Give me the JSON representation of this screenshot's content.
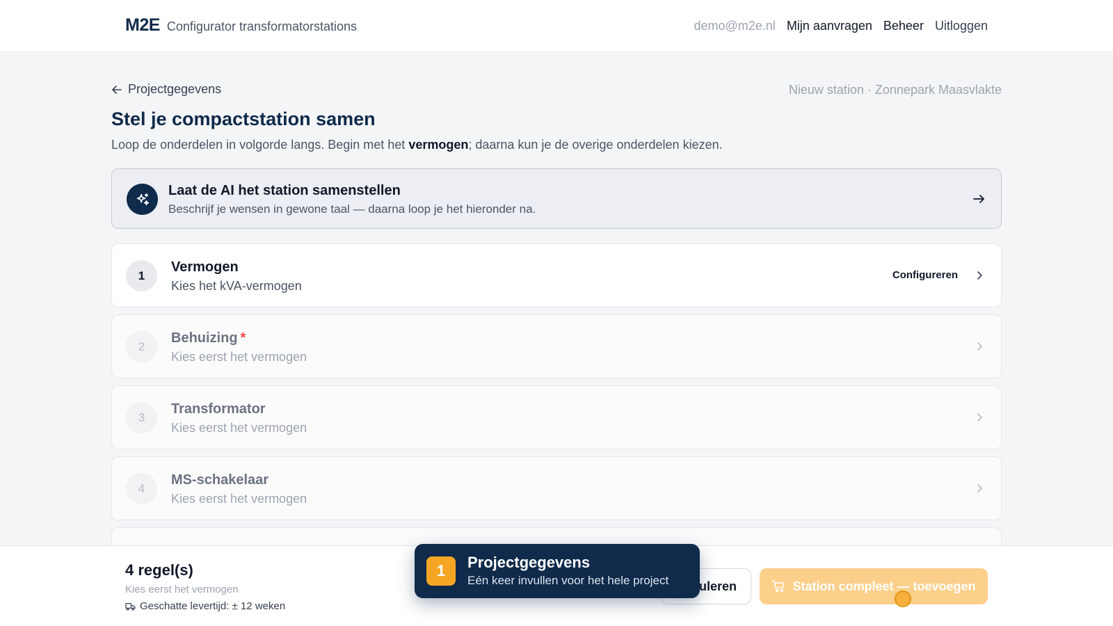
{
  "header": {
    "logo": "M2E",
    "app_subtitle": "Configurator transformatorstations",
    "user_email": "demo@m2e.nl",
    "nav": [
      "Mijn aanvragen",
      "Beheer",
      "Uitloggen"
    ]
  },
  "breadcrumb": {
    "back_label": "Projectgegevens",
    "context": "Nieuw station · Zonnepark Maasvlakte"
  },
  "page": {
    "title": "Stel je compactstation samen",
    "subtitle_prefix": "Loop de onderdelen in volgorde langs. Begin met het ",
    "subtitle_bold": "vermogen",
    "subtitle_suffix": "; daarna kun je de overige onderdelen kiezen."
  },
  "ai_card": {
    "title": "Laat de AI het station samenstellen",
    "subtitle": "Beschrijf je wensen in gewone taal — daarna loop je het hieronder na."
  },
  "steps": [
    {
      "number": "1",
      "title": "Vermogen",
      "subtitle": "Kies het kVA-vermogen",
      "action": "Configureren",
      "required": false,
      "enabled": true
    },
    {
      "number": "2",
      "title": "Behuizing",
      "subtitle": "Kies eerst het vermogen",
      "action": "",
      "required": true,
      "required_mark": "*",
      "enabled": false
    },
    {
      "number": "3",
      "title": "Transformator",
      "subtitle": "Kies eerst het vermogen",
      "action": "",
      "required": false,
      "enabled": false
    },
    {
      "number": "4",
      "title": "MS-schakelaar",
      "subtitle": "Kies eerst het vermogen",
      "action": "",
      "required": false,
      "enabled": false
    }
  ],
  "footer": {
    "line_count": "4 regel(s)",
    "hint": "Kies eerst het vermogen",
    "lead_time": "Geschatte levertijd: ± 12 weken",
    "cancel_label": "Annuleren",
    "cancel_visible_label": "uleren",
    "primary_label": "Station compleet — toevoegen"
  },
  "tour": {
    "step": "1",
    "title": "Projectgegevens",
    "subtitle": "Eén keer invullen voor het hele project"
  },
  "colors": {
    "navy": "#0f2a4a",
    "accent_orange": "#f5a524",
    "primary_disabled": "#fccf8a",
    "required": "#ef4444"
  }
}
